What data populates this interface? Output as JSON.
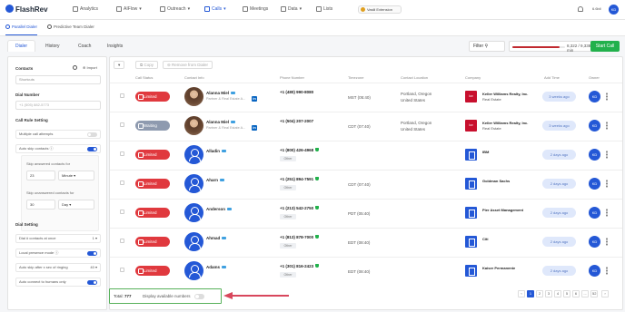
{
  "app": {
    "logo_text": "FlashRev"
  },
  "topnav": {
    "items": [
      {
        "label": "Analytics",
        "icon": "chart-icon"
      },
      {
        "label": "AIFlow",
        "icon": "flow-icon"
      },
      {
        "label": "Outreach",
        "icon": "send-icon"
      },
      {
        "label": "Calls",
        "icon": "phone-icon",
        "active": true
      },
      {
        "label": "Meetings",
        "icon": "calendar-icon"
      },
      {
        "label": "Data",
        "icon": "database-icon"
      },
      {
        "label": "Lists",
        "icon": "list-icon"
      }
    ],
    "account": "Vasili Extension",
    "credits": "6.6bil",
    "avatar": "KD"
  },
  "subnav": {
    "items": [
      {
        "label": "Parallel Dialer",
        "active": true
      },
      {
        "label": "Predictive Team Dialer",
        "active": false
      }
    ]
  },
  "tabs": [
    "Dialer",
    "History",
    "Coach",
    "Insights"
  ],
  "filter": {
    "label": "Filter",
    "progress_text": "8,322 / 9,338 min",
    "progress_fraction": 0.89,
    "start_label": "Start Call"
  },
  "left": {
    "contacts_title": "Contacts",
    "import_label": "Import",
    "contacts_placeholder": "Shortcuts",
    "dial_number_title": "Dial Number",
    "dial_number_value": "+1 (505) 882-5773",
    "rule_title": "Call Rule Setting",
    "rules": [
      {
        "label": "Multiple call attempts",
        "on": false
      },
      {
        "label": "Auto skip contacts",
        "on": true
      }
    ],
    "skip_answered_label": "Skip answered contacts for",
    "skip_answered_value": "23",
    "skip_answered_unit": "Minute",
    "skip_unanswered_label": "Skip unanswered contacts for",
    "skip_unanswered_value": "30",
    "skip_unanswered_unit": "Day",
    "dial_setting_title": "Dial Setting",
    "dial_rows": [
      {
        "label": "Dial # contacts at once",
        "value": "1"
      },
      {
        "label": "Local presence mode",
        "toggle": true
      },
      {
        "label": "Auto skip after x sec of ringing",
        "value": "40"
      },
      {
        "label": "Auto connect to humans only",
        "toggle": true
      }
    ]
  },
  "table": {
    "copy_label": "Copy",
    "remove_label": "Remove from Dialer",
    "headers": [
      "Call Status",
      "Contact Info",
      "Phone Number",
      "Timezone",
      "Contact Location",
      "Company",
      "Add Time",
      "Owner"
    ],
    "rows": [
      {
        "status": "Limited",
        "name": "Alanna Miel",
        "desc": "Partner & Real Estate A...",
        "photo": true,
        "linkedin": true,
        "phone": "+1 (480) 990-8080",
        "phone_tag": "",
        "tz": "MST (05:40)",
        "loc1": "Portland, Oregon",
        "loc2": "United States",
        "company": "Keller Williams Realty, Inc.",
        "industry": "Real Estate",
        "logo": "red",
        "ago": "3 weeks ago",
        "owner": "KD"
      },
      {
        "status": "Waiting",
        "name": "Alanna Miel",
        "desc": "Partner & Real Estate A...",
        "photo": true,
        "linkedin": true,
        "phone": "+1 (504) 207-2007",
        "phone_tag": "",
        "tz": "CDT (07:40)",
        "loc1": "Portland, Oregon",
        "loc2": "United States",
        "company": "Keller Williams Realty, Inc.",
        "industry": "Real Estate",
        "logo": "red",
        "ago": "3 weeks ago",
        "owner": "KD"
      },
      {
        "status": "Limited",
        "name": "Alladin",
        "desc": "",
        "photo": false,
        "linkedin": false,
        "phone": "+1 (800) 426-4968",
        "phone_tag": "Other",
        "tz": "",
        "loc1": "",
        "loc2": "",
        "company": "IBM",
        "industry": "",
        "logo": "blue",
        "ago": "2 days ago",
        "owner": "KD"
      },
      {
        "status": "Limited",
        "name": "Aharn",
        "desc": "",
        "photo": false,
        "linkedin": false,
        "phone": "+1 (251) 894-7591",
        "phone_tag": "Other",
        "tz": "CDT (07:40)",
        "loc1": "",
        "loc2": "",
        "company": "Goldman Sachs",
        "industry": "",
        "logo": "blue",
        "ago": "2 days ago",
        "owner": "KD"
      },
      {
        "status": "Limited",
        "name": "Anderson",
        "desc": "",
        "photo": false,
        "linkedin": false,
        "phone": "+1 (213) 542-2750",
        "phone_tag": "Other",
        "tz": "PDT (05:40)",
        "loc1": "",
        "loc2": "",
        "company": "Pier Asset Management",
        "industry": "",
        "logo": "blue",
        "ago": "2 days ago",
        "owner": "KD"
      },
      {
        "status": "Limited",
        "name": "Ahmad",
        "desc": "",
        "photo": false,
        "linkedin": false,
        "phone": "+1 (813) 878-7000",
        "phone_tag": "Other",
        "tz": "EDT (08:40)",
        "loc1": "",
        "loc2": "",
        "company": "Citi",
        "industry": "",
        "logo": "blue",
        "ago": "2 days ago",
        "owner": "KD"
      },
      {
        "status": "Limited",
        "name": "Adams",
        "desc": "",
        "photo": false,
        "linkedin": false,
        "phone": "+1 (301) 816-2423",
        "phone_tag": "Other",
        "tz": "EDT (08:40)",
        "loc1": "",
        "loc2": "",
        "company": "Kaiser Permanente",
        "industry": "",
        "logo": "blue",
        "ago": "2 days ago",
        "owner": "KD"
      }
    ]
  },
  "footer": {
    "total_label": "Total:",
    "total_value": "777",
    "display_label": "Display available numbers",
    "pages": [
      "1",
      "2",
      "3",
      "4",
      "5",
      "6",
      "...",
      "52"
    ],
    "current_page": "1"
  },
  "colors": {
    "accent": "#2458d6",
    "limited": "#e0393e",
    "waiting": "#8e9aaf",
    "start": "#22b14c",
    "highlight": "#57b15a",
    "arrow": "#d8475c"
  }
}
